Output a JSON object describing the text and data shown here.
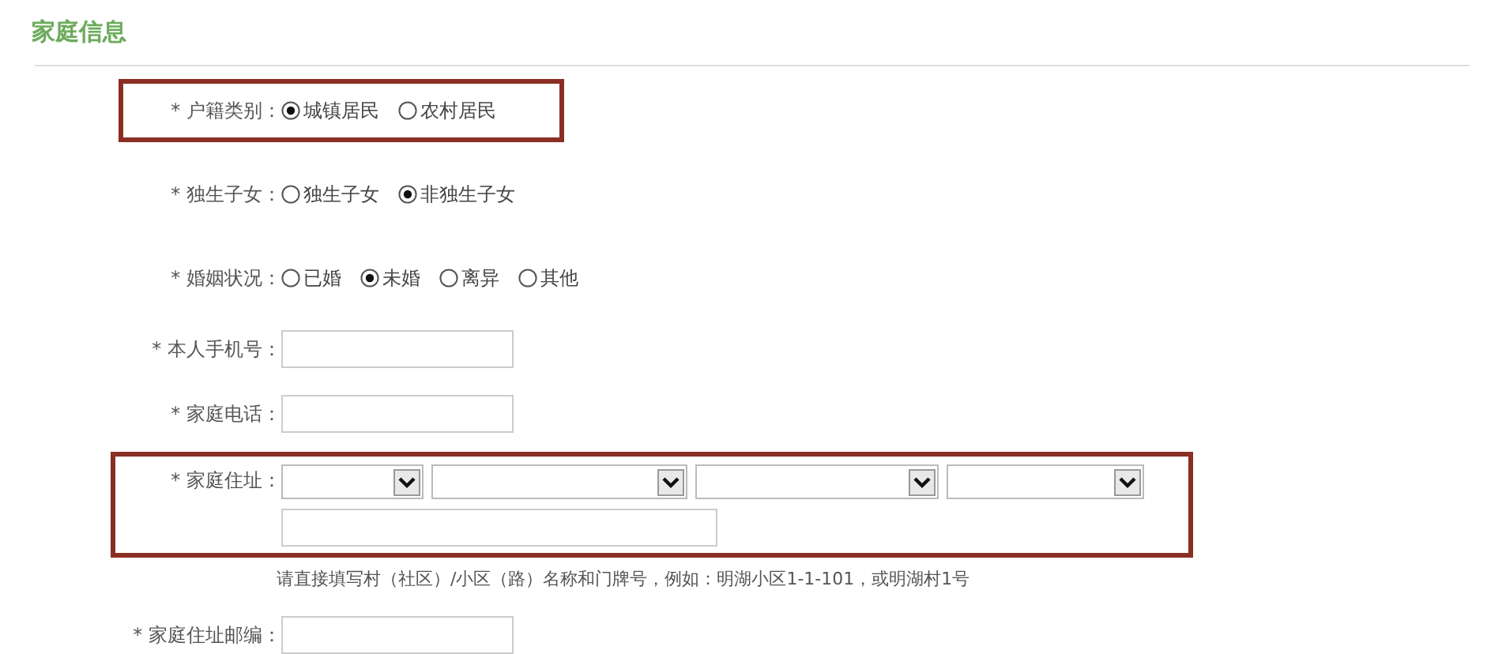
{
  "section": {
    "title": "家庭信息"
  },
  "fields": [
    {
      "kind": "radio",
      "label": "* 户籍类别：",
      "highlighted": true,
      "options": [
        {
          "label": "城镇居民",
          "selected": true
        },
        {
          "label": "农村居民",
          "selected": false
        }
      ]
    },
    {
      "kind": "radio",
      "label": "* 独生子女：",
      "highlighted": false,
      "options": [
        {
          "label": "独生子女",
          "selected": false
        },
        {
          "label": "非独生子女",
          "selected": true
        }
      ]
    },
    {
      "kind": "radio",
      "label": "* 婚姻状况：",
      "highlighted": false,
      "options": [
        {
          "label": "已婚",
          "selected": false
        },
        {
          "label": "未婚",
          "selected": true
        },
        {
          "label": "离异",
          "selected": false
        },
        {
          "label": "其他",
          "selected": false
        }
      ]
    },
    {
      "kind": "text",
      "label": "* 本人手机号：",
      "highlighted": false
    },
    {
      "kind": "text",
      "label": "* 家庭电话：",
      "highlighted": false
    },
    {
      "kind": "address",
      "label": "* 家庭住址：",
      "highlighted": true,
      "hint": "请直接填写村（社区）/小区（路）名称和门牌号，例如：明湖小区1-1-101，或明湖村1号"
    },
    {
      "kind": "text",
      "label": "* 家庭住址邮编：",
      "highlighted": false
    }
  ]
}
